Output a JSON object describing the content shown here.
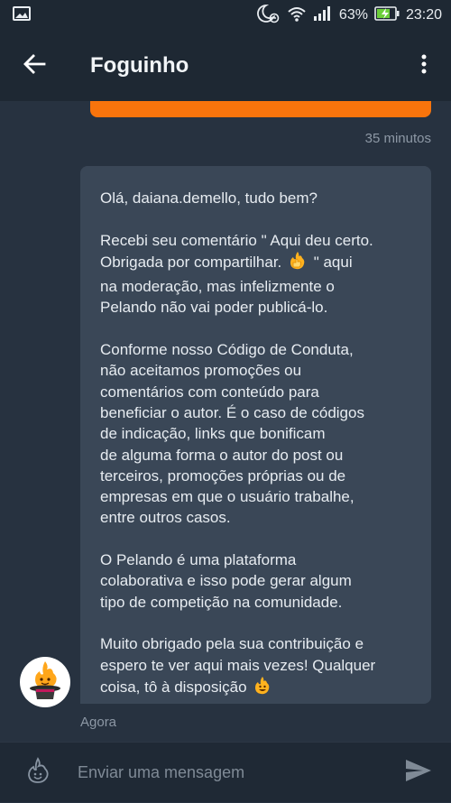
{
  "status_bar": {
    "battery_percent": "63%",
    "time": "23:20",
    "icons": [
      "image-icon",
      "moon-alarm-icon",
      "wifi-icon",
      "signal-icon",
      "battery-charging-icon"
    ]
  },
  "header": {
    "title": "Foguinho",
    "back_icon": "back-arrow-icon",
    "menu_icon": "more-vertical-icon"
  },
  "conversation": {
    "previous_message_time": "35 minutos",
    "message": {
      "paragraphs": [
        {
          "text": "Olá, daiana.demello, tudo bem?"
        },
        {
          "before": "Recebi seu comentário \" Aqui deu certo.\nObrigada por compartilhar. ",
          "emoji": "thumbs-up-emoji",
          "after": " \" aqui\nna moderação, mas infelizmente o\nPelando não vai poder publicá-lo."
        },
        {
          "text": "Conforme nosso Código de Conduta,\nnão aceitamos promoções ou\ncomentários com conteúdo para\nbeneficiar o autor. É o caso de códigos\nde indicação, links que bonificam\nde alguma forma o autor do post ou\nterceiros, promoções próprias ou de\nempresas em que o usuário trabalhe,\nentre outros casos."
        },
        {
          "text": "O Pelando é uma plataforma\ncolaborativa e isso pode gerar algum\ntipo de competição na comunidade."
        },
        {
          "before": "Muito obrigado pela sua contribuição e\nespero te ver aqui mais vezes! Qualquer\ncoisa, tô à disposição ",
          "emoji": "grinning-fire-emoji",
          "after": ""
        }
      ],
      "time": "Agora"
    },
    "avatar_icon": "foguinho-mascot-avatar"
  },
  "composer": {
    "placeholder": "Enviar uma mensagem",
    "value": "",
    "emoji_icon": "fire-smiley-icon",
    "send_icon": "send-icon"
  },
  "colors": {
    "background": "#273240",
    "bar": "#1e2833",
    "bubble": "#3a4757",
    "accent": "#f8740c",
    "muted_text": "#8d98a5"
  }
}
